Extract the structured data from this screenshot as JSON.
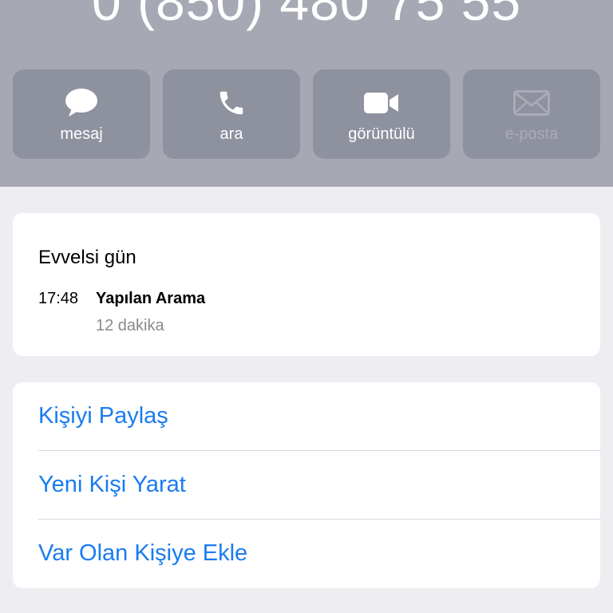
{
  "contact": {
    "phone_number": "0 (850) 480 75 55"
  },
  "quick_actions": [
    {
      "label": "mesaj",
      "icon": "message-bubble-icon",
      "enabled": true
    },
    {
      "label": "ara",
      "icon": "phone-icon",
      "enabled": true
    },
    {
      "label": "görüntülü",
      "icon": "video-camera-icon",
      "enabled": true
    },
    {
      "label": "e-posta",
      "icon": "envelope-icon",
      "enabled": false
    }
  ],
  "call_history": {
    "day_label": "Evvelsi gün",
    "entries": [
      {
        "time": "17:48",
        "type": "Yapılan Arama",
        "duration": "12 dakika"
      }
    ]
  },
  "contact_actions": [
    {
      "label": "Kişiyi Paylaş"
    },
    {
      "label": "Yeni Kişi Yarat"
    },
    {
      "label": "Var Olan Kişiye Ekle"
    }
  ],
  "colors": {
    "header_background": "#a6a8b4",
    "action_button_background": "#8e919e",
    "link_blue": "#1a7cf0",
    "page_background": "#eeeef2",
    "secondary_text": "#8a8a8e"
  }
}
